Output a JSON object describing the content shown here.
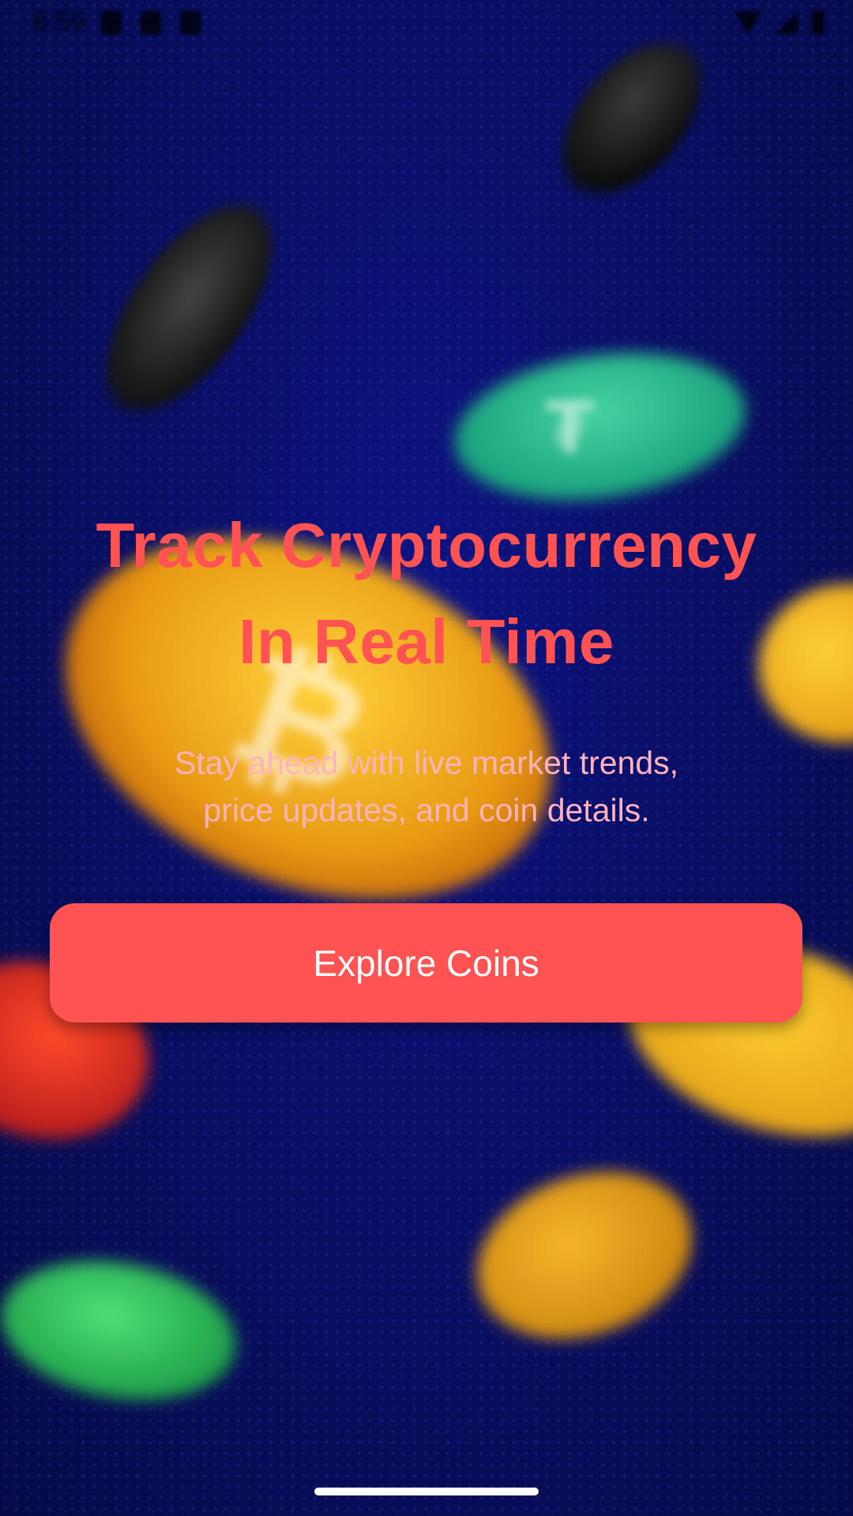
{
  "status_bar": {
    "time": "6:59",
    "icons": [
      "play-protect-icon",
      "sd-card-icon",
      "download-icon",
      "wifi-icon",
      "signal-icon",
      "battery-icon"
    ]
  },
  "hero": {
    "headline_line1": "Track Cryptocurrency",
    "headline_line2": "In Real Time",
    "subtitle_line1": "Stay ahead with live market trends,",
    "subtitle_line2": "price updates, and coin details."
  },
  "cta": {
    "label": "Explore Coins"
  },
  "colors": {
    "accent": "#ff5252",
    "subtitle": "#ffb3bd",
    "background": "#0a0f6a"
  }
}
